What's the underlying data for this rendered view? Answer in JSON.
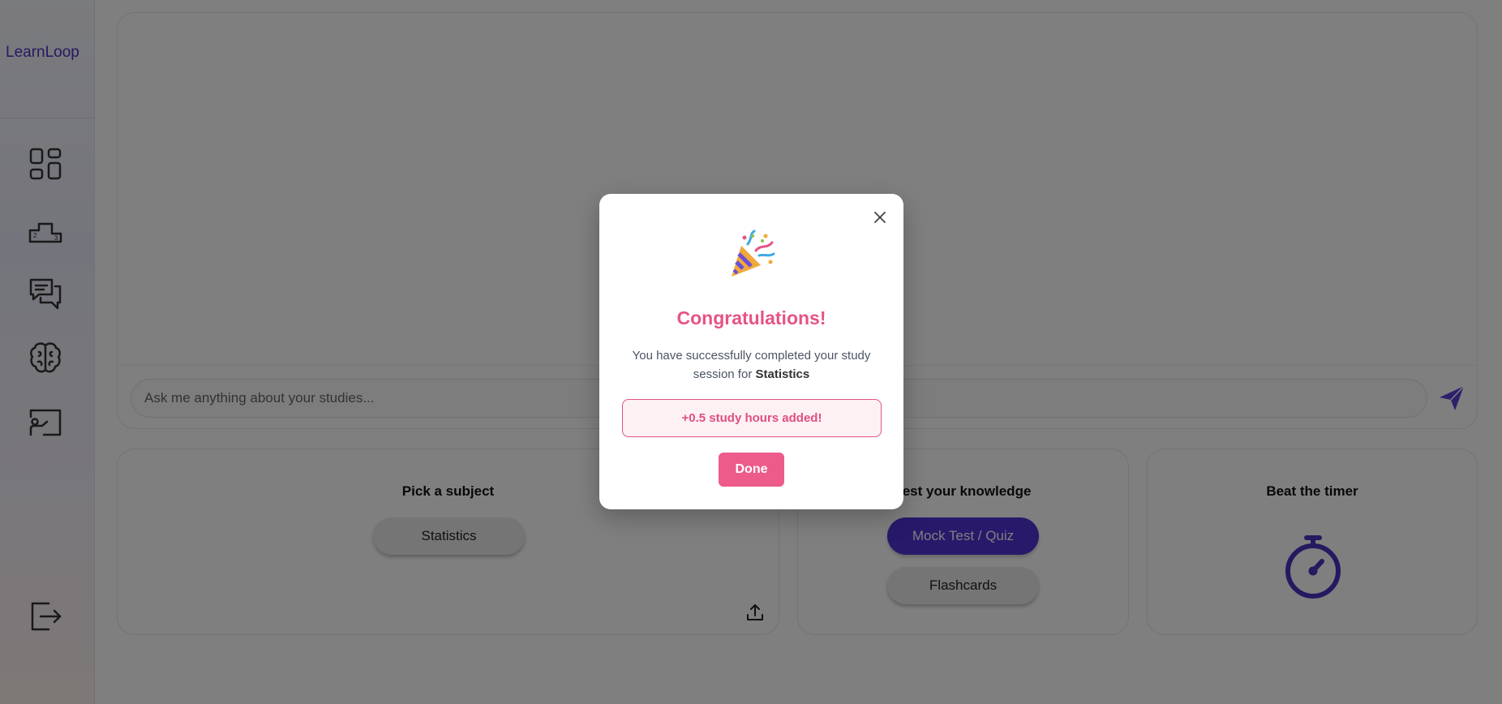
{
  "app": {
    "name": "LearnLoop",
    "brand_color": "#4b32c3"
  },
  "sidebar": {
    "items": [
      {
        "icon": "dashboard-icon"
      },
      {
        "icon": "leaderboard-podium-icon"
      },
      {
        "icon": "chat-bubbles-icon"
      },
      {
        "icon": "brain-icon"
      },
      {
        "icon": "teacher-board-icon"
      }
    ],
    "logout_icon": "logout-icon"
  },
  "chat": {
    "placeholder": "Ask me anything about your studies...",
    "send_icon": "send-icon"
  },
  "cards": {
    "subject": {
      "title": "Pick a subject",
      "selected_subject": "Statistics",
      "upload_icon": "upload-icon"
    },
    "knowledge": {
      "title": "Test your knowledge",
      "quiz_label": "Mock Test / Quiz",
      "flashcards_label": "Flashcards"
    },
    "timer": {
      "title": "Beat the timer",
      "icon": "stopwatch-icon"
    }
  },
  "modal": {
    "icon": "party-popper-icon",
    "title": "Congratulations!",
    "message": "You have successfully completed your study session for",
    "subject": "Statistics",
    "reward": "+0.5 study hours added!",
    "done_label": "Done",
    "accent_color": "#e65387"
  }
}
